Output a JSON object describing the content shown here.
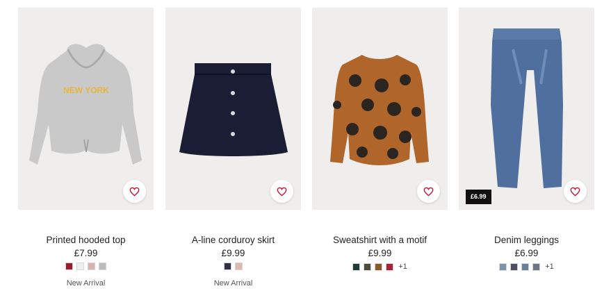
{
  "products": [
    {
      "title": "Printed hooded top",
      "price": "£7.99",
      "badge": "New Arrival",
      "favourite_icon": "heart-icon",
      "swatches": [
        "#9b1c2e",
        "#eeeeee",
        "#d8b3ad",
        "#bcbcbc"
      ],
      "more": ""
    },
    {
      "title": "A-line corduroy skirt",
      "price": "£9.99",
      "badge": "New Arrival",
      "favourite_icon": "heart-icon",
      "swatches": [
        "#2f3245",
        "#dbb8b2"
      ],
      "more": ""
    },
    {
      "title": "Sweatshirt with a motif",
      "price": "£9.99",
      "badge": "",
      "favourite_icon": "heart-icon",
      "swatches": [
        "#1f3b33",
        "#4a4d3f",
        "#8a5a2c",
        "#a8203a"
      ],
      "more": "+1"
    },
    {
      "title": "Denim leggings",
      "price": "£6.99",
      "price_tag": "£6.99",
      "badge": "",
      "favourite_icon": "heart-icon",
      "swatches": [
        "#7e93b0",
        "#4a5068",
        "#6b7f9e",
        "#6e7686"
      ],
      "more": "+1"
    }
  ],
  "colors": {
    "heart": "#c4102e",
    "image_bg": "#efeeec"
  }
}
